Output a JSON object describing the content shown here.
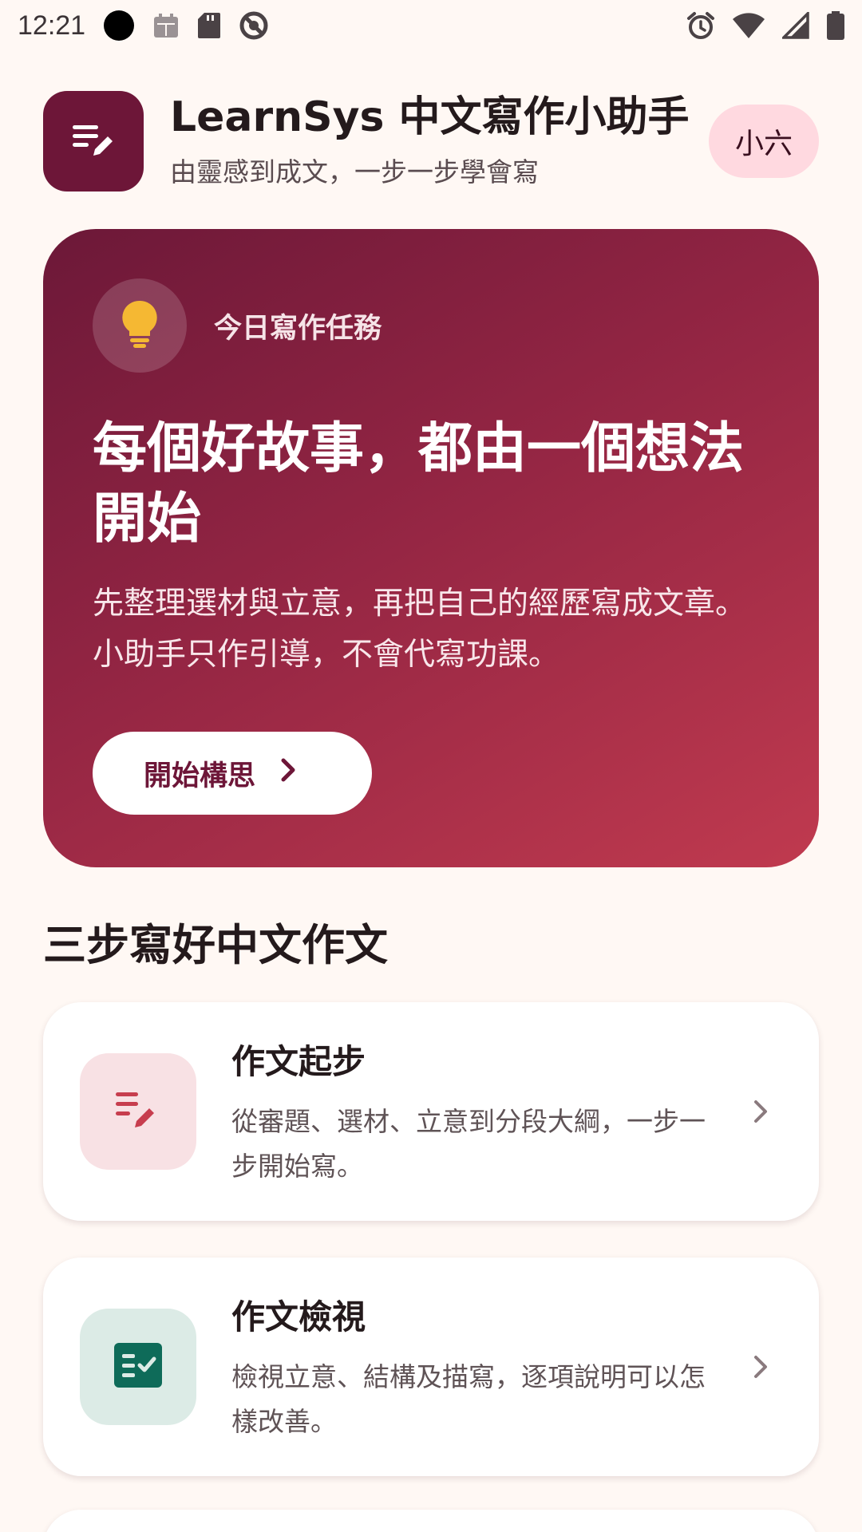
{
  "status_bar": {
    "time": "12:21"
  },
  "header": {
    "title": "LearnSys 中文寫作小助手",
    "subtitle": "由靈感到成文，一步一步學會寫",
    "user": "小六"
  },
  "hero": {
    "task_label": "今日寫作任務",
    "title": "每個好故事，都由一個想法開始",
    "description": "先整理選材與立意，再把自己的經歷寫成文章。小助手只作引導，不會代寫功課。",
    "button_label": "開始構思"
  },
  "section": {
    "title": "三步寫好中文作文"
  },
  "steps": [
    {
      "title": "作文起步",
      "description": "從審題、選材、立意到分段大綱，一步一步開始寫。",
      "icon": "edit-notes-icon",
      "icon_bg": "#f8e1e4",
      "icon_color": "#c73d4e"
    },
    {
      "title": "作文檢視",
      "description": "檢視立意、結構及描寫，逐項說明可以怎樣改善。",
      "icon": "checklist-icon",
      "icon_bg": "#dcebe6",
      "icon_color": "#0e6b59"
    }
  ],
  "colors": {
    "brand": "#6d1638",
    "hero_end": "#c03a4f",
    "background": "#fff8f4"
  }
}
